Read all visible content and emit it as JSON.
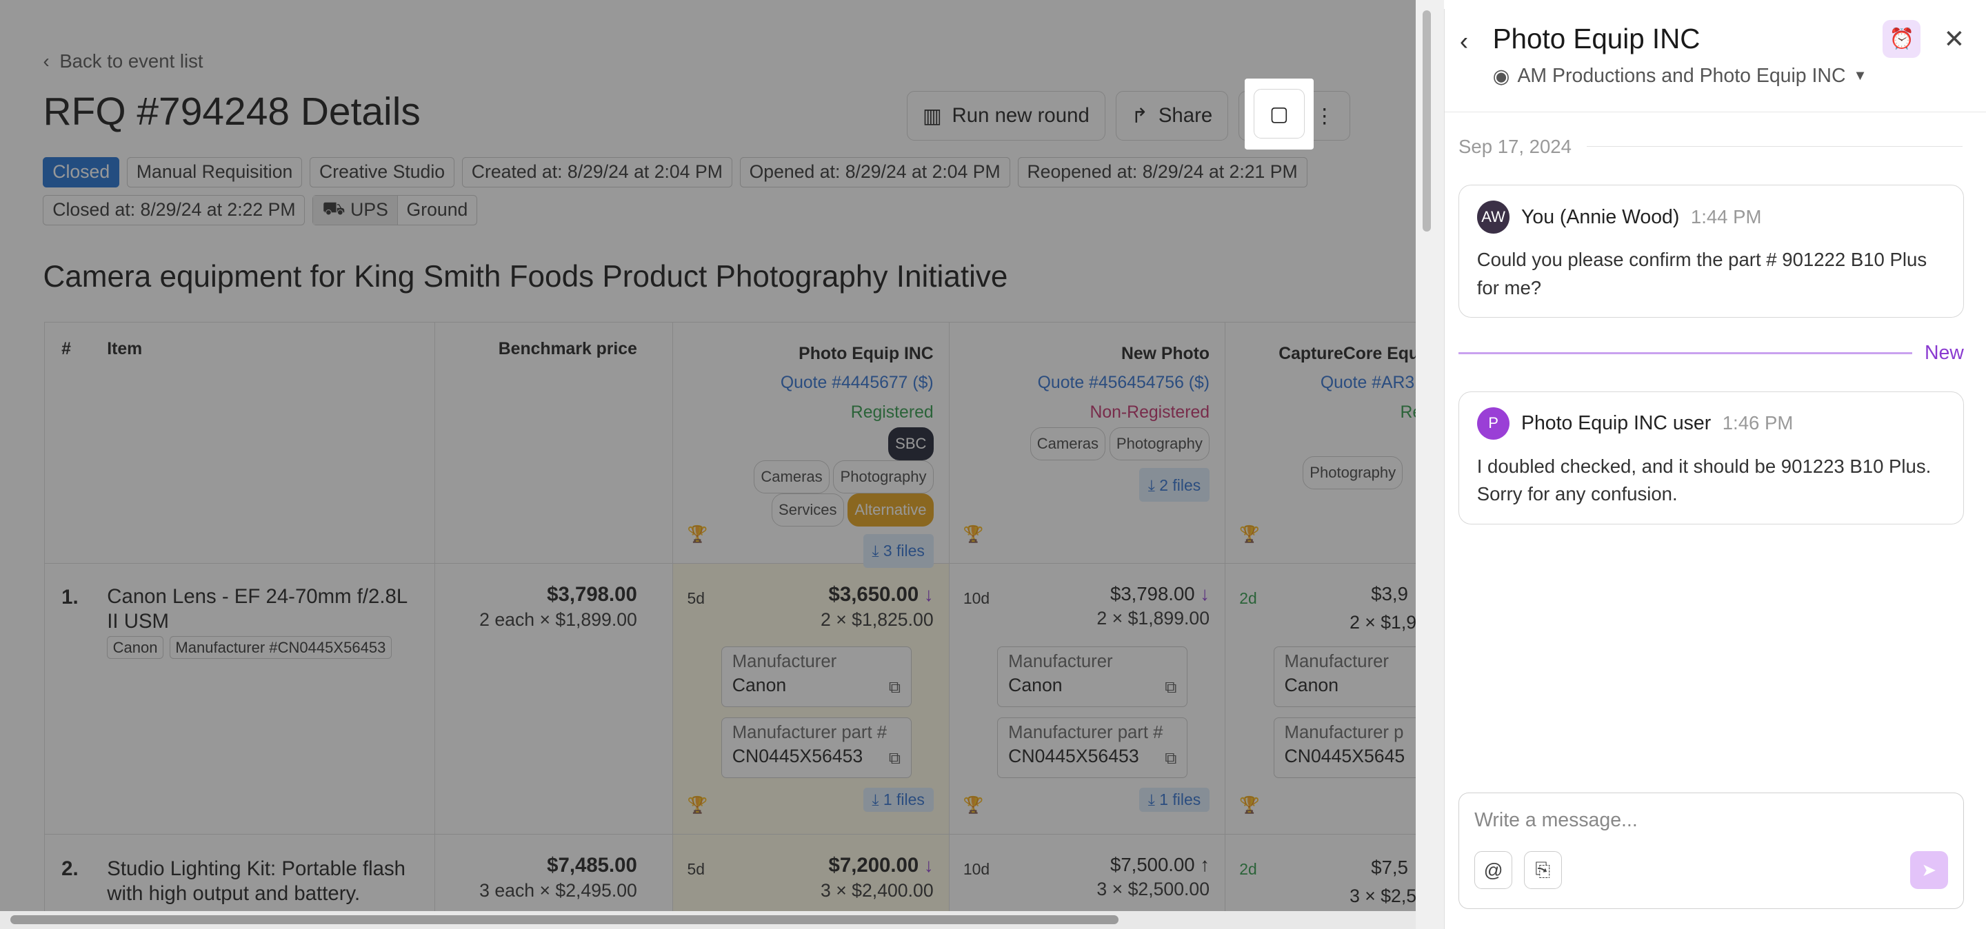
{
  "header": {
    "back_label": "Back to event list",
    "title": "RFQ #794248 Details",
    "run_round_label": "Run new round",
    "share_label": "Share"
  },
  "tags": {
    "status": "Closed",
    "t1": "Manual Requisition",
    "t2": "Creative Studio",
    "t3": "Created at: 8/29/24 at 2:04 PM",
    "t4": "Opened at: 8/29/24 at 2:04 PM",
    "t5": "Reopened at: 8/29/24 at 2:21 PM",
    "t6": "Closed at: 8/29/24 at 2:22 PM",
    "carrier": "UPS",
    "service": "Ground"
  },
  "subtitle": "Camera equipment for King Smith Foods Product Photography Initiative",
  "table": {
    "h_num": "#",
    "h_item": "Item",
    "h_bench": "Benchmark price",
    "v1": {
      "name": "Photo Equip INC",
      "quote": "Quote #4445677 ($)",
      "reg": "Registered",
      "sbc": "SBC",
      "c1": "Cameras",
      "c2": "Photography",
      "c3": "Services",
      "alt": "Alternative",
      "files": "⤓ 3 files"
    },
    "v2": {
      "name": "New Photo",
      "quote": "Quote #456454756 ($)",
      "reg": "Non-Registered",
      "c1": "Cameras",
      "c2": "Photography",
      "files": "⤓ 2 files"
    },
    "v3": {
      "name": "CaptureCore Equ",
      "quote": "Quote #AR3",
      "reg": "Re",
      "c1": "Photography"
    },
    "row1": {
      "num": "1.",
      "item": "Canon Lens - EF 24-70mm f/2.8L II USM",
      "brand": "Canon",
      "mfr": "Manufacturer #CN0445X56453",
      "bench": "$3,798.00",
      "bench_sub": "2 each × $1,899.00",
      "v1_days": "5d",
      "v1_price": "$3,650.00",
      "v1_sub": "2 × $1,825.00",
      "v2_days": "10d",
      "v2_price": "$3,798.00",
      "v2_sub": "2 × $1,899.00",
      "v3_days": "2d",
      "v3_price": "$3,9",
      "v3_sub": "2 × $1,9",
      "mfr_label": "Manufacturer",
      "mfr_val": "Canon",
      "part_label": "Manufacturer part #",
      "part_label_cut": "Manufacturer p",
      "part_val": "CN0445X56453",
      "part_val_cut": "CN0445X5645",
      "files": "⤓ 1 files"
    },
    "row2": {
      "num": "2.",
      "item": "Studio Lighting Kit: Portable flash with high output and battery.",
      "bench": "$7,485.00",
      "bench_sub": "3 each × $2,495.00",
      "v1_days": "5d",
      "v1_price": "$7,200.00",
      "v1_sub": "3 × $2,400.00",
      "v2_days": "10d",
      "v2_price": "$7,500.00",
      "v2_sub": "3 × $2,500.00",
      "v3_days": "2d",
      "v3_price": "$7,5",
      "v3_sub": "3 × $2,5"
    }
  },
  "panel": {
    "title": "Photo Equip INC",
    "participants": "AM Productions and Photo Equip INC",
    "date": "Sep 17, 2024",
    "m1": {
      "initials": "AW",
      "name": "You (Annie Wood)",
      "time": "1:44 PM",
      "text": "Could you please confirm the part # 901222 B10 Plus for me?"
    },
    "new_label": "New",
    "m2": {
      "initials": "P",
      "name": "Photo Equip INC user",
      "time": "1:46 PM",
      "text": "I doubled checked, and it should be 901223 B10 Plus. Sorry for any confusion."
    },
    "placeholder": "Write a message..."
  },
  "colors": {
    "accent": "#8a3ad0",
    "link": "#2f6fd0",
    "closed": "#1f6fd1"
  }
}
